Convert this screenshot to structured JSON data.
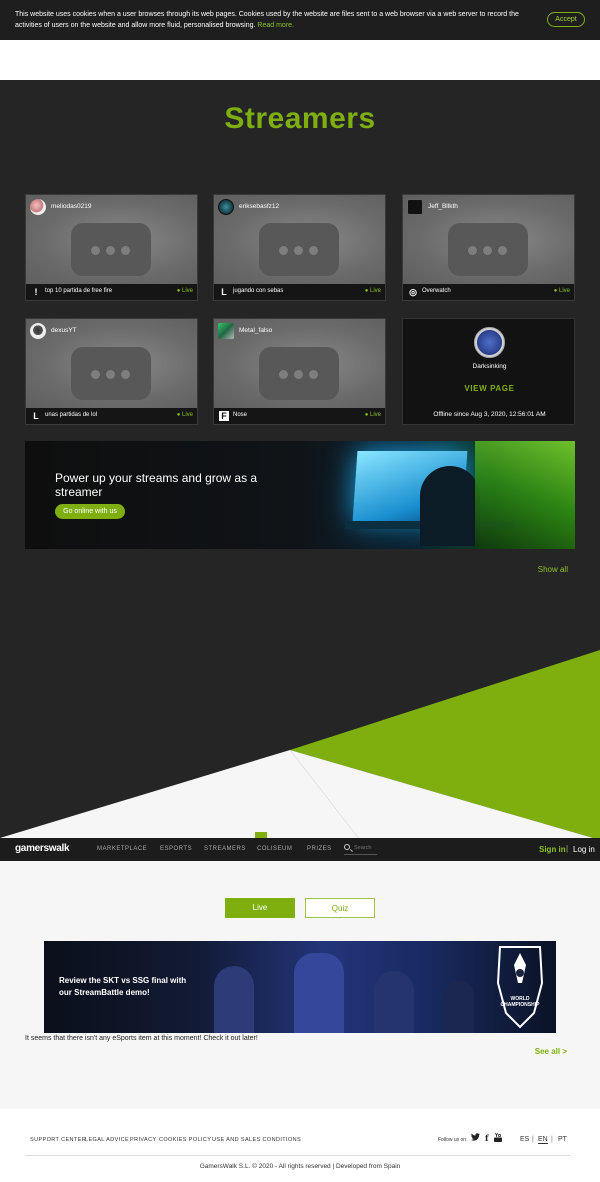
{
  "cookie": {
    "text": "This website uses cookies when a user browses through its web pages. Cookies used by the website are files sent to a web browser via a web server to record the activities of users on the website and allow more fluid, personalised browsing.",
    "read_more": "Read more.",
    "accept": "Accept"
  },
  "streamers": {
    "title": "Streamers",
    "cards": [
      {
        "user": "meliodas0219",
        "game": "top 10 partida de free fire",
        "status": "Live",
        "game_icon": "!"
      },
      {
        "user": "eriksebasfz12",
        "game": "jugando con sebas",
        "status": "Live",
        "game_icon": "L"
      },
      {
        "user": "Jeff_Bllkth",
        "game": "Overwatch",
        "status": "Live",
        "game_icon": "◎"
      },
      {
        "user": "dexusYT",
        "game": "unas partidas de lol",
        "status": "Live",
        "game_icon": "L"
      },
      {
        "user": "Metal_falso",
        "game": "Nose",
        "status": "Live",
        "game_icon": "F"
      }
    ],
    "offline": {
      "user": "Darksinking",
      "view_page": "VIEW PAGE",
      "since": "Offline since Aug 3, 2020, 12:56:01 AM"
    },
    "banner": {
      "text": "Power up your streams and grow as a streamer",
      "button": "Go online with us"
    },
    "show_all": "Show all"
  },
  "nav": {
    "logo": "gamerswalk",
    "items": [
      "MARKETPLACE",
      "ESPORTS",
      "STREAMERS",
      "COLISEUM",
      "PRIZES"
    ],
    "search_placeholder": "Search",
    "sign_in": "Sign in",
    "separator": "|",
    "log_in": "Log in"
  },
  "esports": {
    "tabs": [
      "Live",
      "Quiz"
    ],
    "promo_text": "Review the SKT vs SSG final with our StreamBattle demo!",
    "promo_badge": "WORLD CHAMPIONSHIP",
    "empty_message": "It seems that there isn't any eSports item at this moment! Check it out later!",
    "see_all": "See all >"
  },
  "footer": {
    "links": [
      "SUPPORT CENTER",
      "LEGAL ADVICE",
      "PRIVACY",
      "COOKIES POLICY",
      "USE AND SALES CONDITIONS"
    ],
    "follow_us": "Follow us on:",
    "social": [
      "twitter-icon",
      "facebook-icon",
      "youtube-icon"
    ],
    "languages": [
      "ES",
      "EN",
      "PT"
    ],
    "lang_separator": "|",
    "copyright": "GamersWalk S.L. © 2020 - All rights reserved | Developed from Spain"
  },
  "colors": {
    "accent": "#7eaf0e",
    "dark_bg": "#252525",
    "nav_bg": "#1c1c1c",
    "light_bg": "#f6f6f6"
  }
}
